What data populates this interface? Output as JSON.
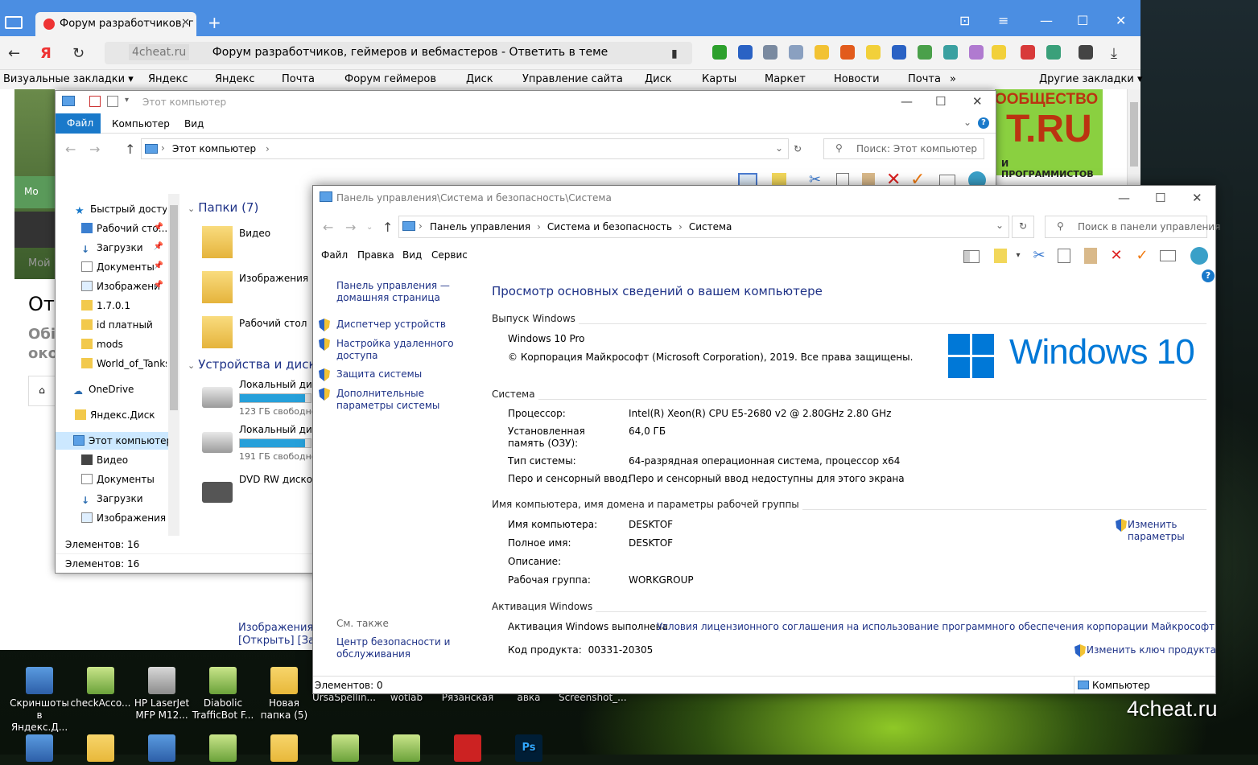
{
  "desktop": {
    "icons": [
      {
        "label": "Скриншоты в Яндекс.Д...",
        "kind": "app"
      },
      {
        "label": "checkAcco...",
        "kind": "green"
      },
      {
        "label": "HP LaserJet MFP M12...",
        "kind": "printer"
      },
      {
        "label": "Diabolic TrafficBot F...",
        "kind": "green"
      },
      {
        "label": "Новая папка (5)",
        "kind": "folder"
      }
    ],
    "partial_labels": [
      "UrsaSpellin...",
      "wotlab",
      "Рязанская",
      "авка",
      "Screenshot_..."
    ],
    "watermark": "4cheat.ru"
  },
  "browser": {
    "tab_title": "Форум разработчиков, г",
    "new_tab": "+",
    "url_host": "4cheat.ru",
    "url_title": "Форум разработчиков, геймеров и вебмастеров - Ответить в теме",
    "bookmarks": [
      "Визуальные закладки ▾",
      "Яндекс",
      "Яндекс",
      "Почта",
      "Форум геймеров",
      "Диск",
      "Управление сайта",
      "Диск",
      "Карты",
      "Маркет",
      "Новости",
      "Почта",
      "»",
      "Другие закладки ▾"
    ],
    "page": {
      "sidebar_green": "Мо",
      "sidebar_grey": "Мой",
      "heading_partial": "От",
      "subtext_partial_1": "Обі",
      "subtext_partial_2": "око",
      "banner_line1": "ООБЩЕСТВО",
      "banner_line2": "T.RU",
      "banner_line3": "И ПРОГРАММИСТОВ",
      "link_images": "Изображения",
      "link_open": "[Открыть] [Загр"
    }
  },
  "explorer": {
    "title": "Этот компьютер",
    "ribbon_tabs": [
      "Файл",
      "Компьютер",
      "Вид"
    ],
    "path": "Этот компьютер",
    "search_placeholder": "Поиск: Этот компьютер",
    "nav": [
      {
        "label": "Быстрый доступ",
        "icon": "star",
        "pin": false
      },
      {
        "label": "Рабочий сто...",
        "icon": "blue",
        "pin": true
      },
      {
        "label": "Загрузки",
        "icon": "dl",
        "pin": true
      },
      {
        "label": "Документы",
        "icon": "doc",
        "pin": true
      },
      {
        "label": "Изображени",
        "icon": "img",
        "pin": true
      },
      {
        "label": "1.7.0.1",
        "icon": "folder",
        "pin": false
      },
      {
        "label": "id платный",
        "icon": "folder",
        "pin": false
      },
      {
        "label": "mods",
        "icon": "folder",
        "pin": false
      },
      {
        "label": "World_of_Tanks_",
        "icon": "folder",
        "pin": false
      },
      {
        "label": "OneDrive",
        "icon": "cloud",
        "pin": false
      },
      {
        "label": "Яндекс.Диск",
        "icon": "folder",
        "pin": false
      },
      {
        "label": "Этот компьютер",
        "icon": "pc",
        "pin": false
      },
      {
        "label": "Видео",
        "icon": "video",
        "pin": false
      },
      {
        "label": "Документы",
        "icon": "doc",
        "pin": false
      },
      {
        "label": "Загрузки",
        "icon": "dl",
        "pin": false
      },
      {
        "label": "Изображения",
        "icon": "img",
        "pin": false
      }
    ],
    "folders_group": "Папки (7)",
    "folders": [
      "Видео",
      "Изображения",
      "Рабочий стол"
    ],
    "devices_group": "Устройства и диски",
    "drives": [
      {
        "label": "Локальный диск",
        "free": "123 ГБ свободно",
        "used_fraction": 0.92
      },
      {
        "label": "Локальный диск",
        "free": "191 ГБ свободно",
        "used_fraction": 0.92
      },
      {
        "label": "DVD RW дисково",
        "free": "",
        "used_fraction": 0
      }
    ],
    "status_inner": "Элементов: 16",
    "status": "Элементов: 16"
  },
  "cpanel": {
    "title": "Панель управления\\Система и безопасность\\Система",
    "breadcrumb": [
      "Панель управления",
      "Система и безопасность",
      "Система"
    ],
    "search_placeholder": "Поиск в панели управления",
    "menu": [
      "Файл",
      "Правка",
      "Вид",
      "Сервис"
    ],
    "side": {
      "home": "Панель управления — домашняя страница",
      "links": [
        "Диспетчер устройств",
        "Настройка удаленного доступа",
        "Защита системы",
        "Дополнительные параметры системы"
      ],
      "see_also": "См. также",
      "security_center": "Центр безопасности и обслуживания"
    },
    "heading": "Просмотр основных сведений о вашем компьютере",
    "edition_section": "Выпуск Windows",
    "edition": "Windows 10 Pro",
    "copyright": "© Корпорация Майкрософт (Microsoft Corporation), 2019. Все права защищены.",
    "logo_text": "Windows 10",
    "system_section": "Система",
    "system_rows": [
      {
        "label": "Процессор:",
        "value": "Intel(R) Xeon(R) CPU E5-2680 v2 @ 2.80GHz   2.80 GHz"
      },
      {
        "label": "Установленная память (ОЗУ):",
        "value": "64,0 ГБ"
      },
      {
        "label": "Тип системы:",
        "value": "64-разрядная операционная система, процессор x64"
      },
      {
        "label": "Перо и сенсорный ввод:",
        "value": "Перо и сенсорный ввод недоступны для этого экрана"
      }
    ],
    "name_section": "Имя компьютера, имя домена и параметры рабочей группы",
    "name_rows": [
      {
        "label": "Имя компьютера:",
        "value": "DESKTOF"
      },
      {
        "label": "Полное имя:",
        "value": "DESKTOF"
      },
      {
        "label": "Описание:",
        "value": ""
      },
      {
        "label": "Рабочая группа:",
        "value": "WORKGROUP"
      }
    ],
    "change_settings": "Изменить параметры",
    "activation_section": "Активация Windows",
    "activation_status": "Активация Windows выполнена",
    "license_link": "Условия лицензионного соглашения на использование программного обеспечения корпорации Майкрософт",
    "product_key_label": "Код продукта:",
    "product_key": "00331-20305",
    "change_key": "Изменить ключ продукта",
    "status_left": "Элементов: 0",
    "status_right": "Компьютер"
  },
  "colors": {
    "accent": "#1979ca",
    "link": "#1e3287",
    "windows_blue": "#0078d7",
    "browser_bar": "#4b8ee2"
  }
}
